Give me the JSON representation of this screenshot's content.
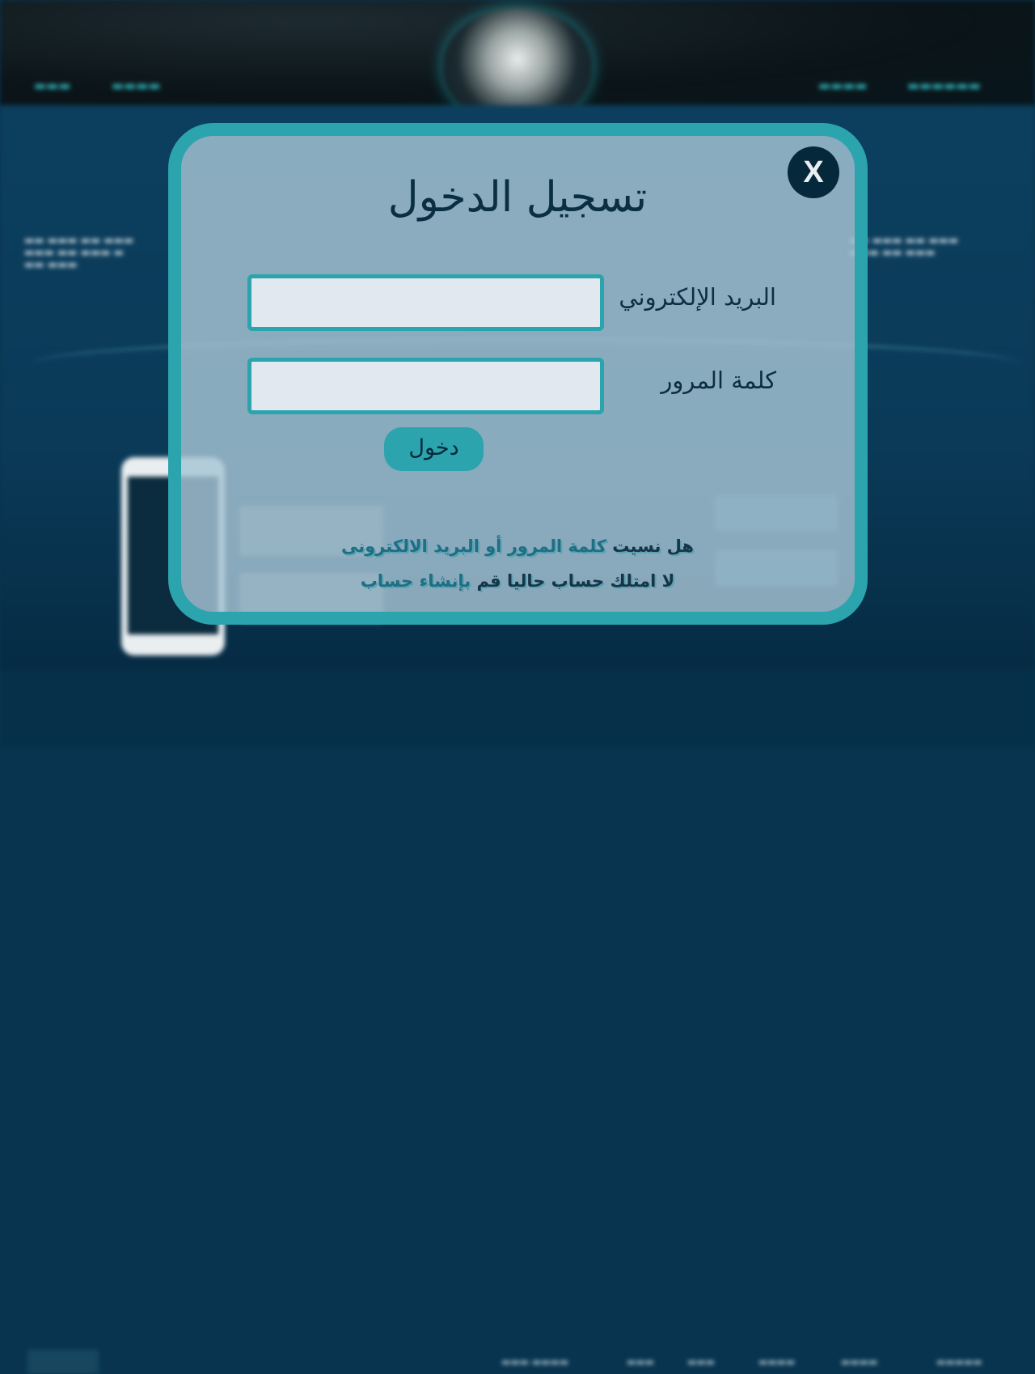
{
  "login_modal": {
    "title": "تسجيل الدخول",
    "close_label": "X",
    "email_label": "البريد الإلكتروني",
    "email_value": "",
    "password_label": "كلمة المرور",
    "password_value": "",
    "submit_label": "دخول",
    "forgot_prefix": "هل نسيت",
    "forgot_password_link": "كلمة المرور",
    "forgot_or": "أو",
    "forgot_email_link": "البريد الالكترونى",
    "no_account_prefix": "لا امتلك حساب حاليا قم",
    "create_account_link": "بإنشاء حساب"
  },
  "colors": {
    "modal_border": "#2ba4ad",
    "close_button": "#06283b",
    "title_text": "#0a2e42",
    "input_background": "#e2e8ef"
  }
}
